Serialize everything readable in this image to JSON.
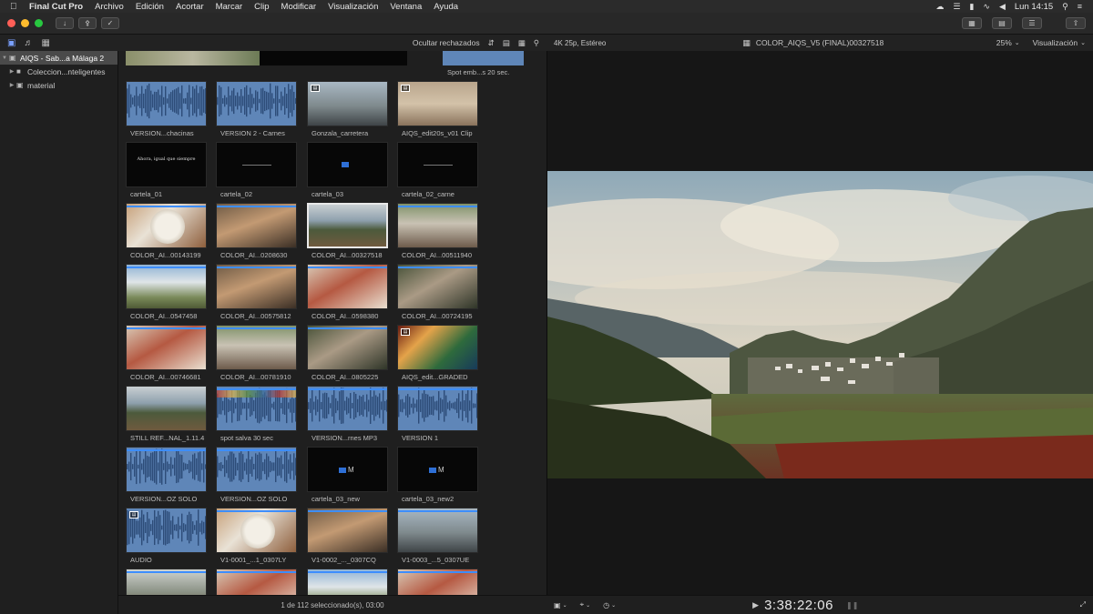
{
  "menubar": {
    "app_name": "Final Cut Pro",
    "items": [
      "Archivo",
      "Edición",
      "Acortar",
      "Marcar",
      "Clip",
      "Modificar",
      "Visualización",
      "Ventana",
      "Ayuda"
    ],
    "clock": "Lun 14:15"
  },
  "sidebar": {
    "library": "AIQS - Sab...a Málaga 2",
    "items": [
      "Coleccion...nteligentes",
      "material"
    ]
  },
  "browser": {
    "filter": "Ocultar rechazados",
    "top_partial_label": "Spot emb...s 20 sec.",
    "footer_status": "1 de 112 seleccionado(s), 03:00",
    "clips": [
      {
        "label": "VERSION...chacinas",
        "kind": "audio"
      },
      {
        "label": "VERSION 2 - Carnes",
        "kind": "audio"
      },
      {
        "label": "Gonzala_carretera",
        "kind": "car",
        "badge": true
      },
      {
        "label": "AIQS_edit20s_v01 Clip",
        "kind": "old",
        "badge": true
      },
      {
        "label": "cartela_01",
        "kind": "card1",
        "card_text": "Ahora, igual que siempre"
      },
      {
        "label": "cartela_02",
        "kind": "tiny"
      },
      {
        "label": "cartela_03",
        "kind": "logo"
      },
      {
        "label": "cartela_02_carne",
        "kind": "tiny"
      },
      {
        "label": "COLOR_AI...00143199",
        "kind": "plate",
        "line": true
      },
      {
        "label": "COLOR_AI...0208630",
        "kind": "woman",
        "line": true
      },
      {
        "label": "COLOR_AI...00327518",
        "kind": "valley",
        "selected": true
      },
      {
        "label": "COLOR_AI...00511940",
        "kind": "table",
        "line": true
      },
      {
        "label": "COLOR_AI...0547458",
        "kind": "house",
        "line": true
      },
      {
        "label": "COLOR_AI...00575812",
        "kind": "woman",
        "line": true
      },
      {
        "label": "COLOR_AI...0598380",
        "kind": "food",
        "line": true
      },
      {
        "label": "COLOR_AI...00724195",
        "kind": "man",
        "line": true
      },
      {
        "label": "COLOR_AI...00746681",
        "kind": "food",
        "line": true
      },
      {
        "label": "COLOR_AI...00781910",
        "kind": "table",
        "line": true
      },
      {
        "label": "COLOR_AI...0805225",
        "kind": "man",
        "line": true
      },
      {
        "label": "AIQS_edit...GRADED",
        "kind": "graded",
        "badge": true
      },
      {
        "label": "STILL REF...NAL_1.11.4",
        "kind": "valley"
      },
      {
        "label": "spot salva 30 sec",
        "kind": "audio2",
        "line": true
      },
      {
        "label": "VERSION...rnes MP3",
        "kind": "audio",
        "line": true
      },
      {
        "label": "VERSION 1",
        "kind": "audio",
        "line": true
      },
      {
        "label": "VERSION...OZ SOLO",
        "kind": "audio",
        "line": true
      },
      {
        "label": "VERSION...OZ SOLO",
        "kind": "audio",
        "line": true
      },
      {
        "label": "cartela_03_new",
        "kind": "logo2",
        "logo_text": "M"
      },
      {
        "label": "cartela_03_new2",
        "kind": "logo2",
        "logo_text": "M"
      },
      {
        "label": "AUDIO",
        "kind": "audio",
        "badge": true
      },
      {
        "label": "V1-0001_...1_0307LY",
        "kind": "plate",
        "line": true
      },
      {
        "label": "V1-0002_..._0307CQ",
        "kind": "woman",
        "line": true
      },
      {
        "label": "V1-0003_...5_0307UE",
        "kind": "car",
        "line": true
      },
      {
        "label": "",
        "kind": "lib",
        "line": true
      },
      {
        "label": "",
        "kind": "food",
        "line": true
      },
      {
        "label": "",
        "kind": "house",
        "line": true
      },
      {
        "label": "",
        "kind": "food",
        "line": true
      }
    ]
  },
  "viewer": {
    "format": "4K 25p, Estéreo",
    "clip_name": "COLOR_AIQS_V5 (FINAL)00327518",
    "zoom": "25%",
    "view_menu": "Visualización",
    "timecode": "3:38:22:06"
  },
  "colors": {
    "accent_blue": "#3d8eff",
    "audio_clip": "#5f86b8",
    "selection_border": "#e8e8e8"
  }
}
